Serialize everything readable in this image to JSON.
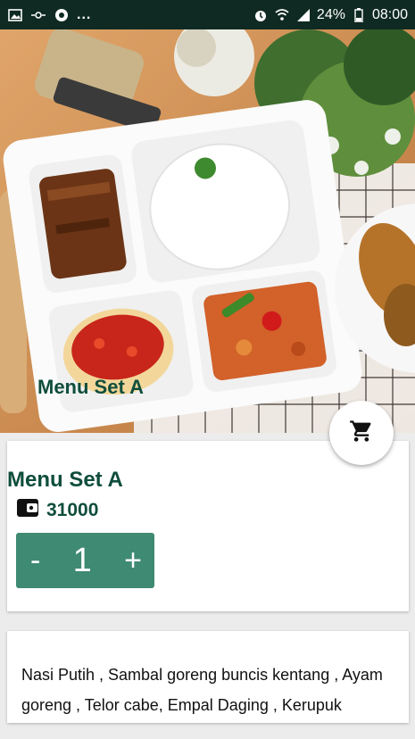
{
  "status_bar": {
    "icons_left": [
      "image-icon",
      "link-icon",
      "chrome-icon"
    ],
    "overflow": "...",
    "battery": "24%",
    "time": "08:00"
  },
  "hero": {
    "caption": "Menu Set A"
  },
  "product": {
    "title": "Menu Set A",
    "price": "31000",
    "quantity": "1",
    "decrement_label": "-",
    "increment_label": "+"
  },
  "description": {
    "text": "Nasi Putih , Sambal goreng buncis kentang , Ayam goreng , Telor cabe, Empal Daging , Kerupuk"
  },
  "colors": {
    "accent": "#0f4d3c",
    "stepper": "#3f8a72",
    "status_bar": "#0f2a22"
  }
}
